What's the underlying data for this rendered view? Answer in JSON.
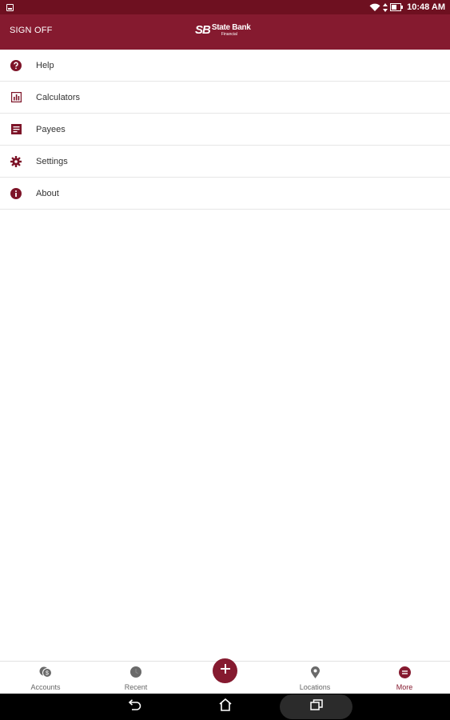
{
  "status_bar": {
    "time": "10:48 AM",
    "icons": [
      "notification-icon",
      "wifi-icon",
      "data-arrows-icon",
      "battery-icon"
    ]
  },
  "header": {
    "sign_off_label": "SIGN OFF",
    "logo_mark": "SB",
    "logo_name": "State Bank",
    "logo_sub": "Financial",
    "background": "#851a2f"
  },
  "menu": {
    "items": [
      {
        "label": "Help",
        "icon": "help-icon"
      },
      {
        "label": "Calculators",
        "icon": "calculator-icon"
      },
      {
        "label": "Payees",
        "icon": "payees-icon"
      },
      {
        "label": "Settings",
        "icon": "gear-icon"
      },
      {
        "label": "About",
        "icon": "info-icon"
      }
    ]
  },
  "tabs": {
    "items": [
      {
        "label": "Accounts",
        "icon": "accounts-icon",
        "active": false
      },
      {
        "label": "Recent",
        "icon": "recent-icon",
        "active": false
      },
      {
        "label": "Locations",
        "icon": "location-pin-icon",
        "active": false
      },
      {
        "label": "More",
        "icon": "more-icon",
        "active": true
      }
    ],
    "fab_icon": "plus-icon"
  },
  "nav_bar": {
    "buttons": [
      "back-icon",
      "home-icon",
      "recents-icon"
    ]
  },
  "colors": {
    "brand": "#851a2f",
    "status_bar": "#6e1020",
    "icon": "#7d1428"
  }
}
